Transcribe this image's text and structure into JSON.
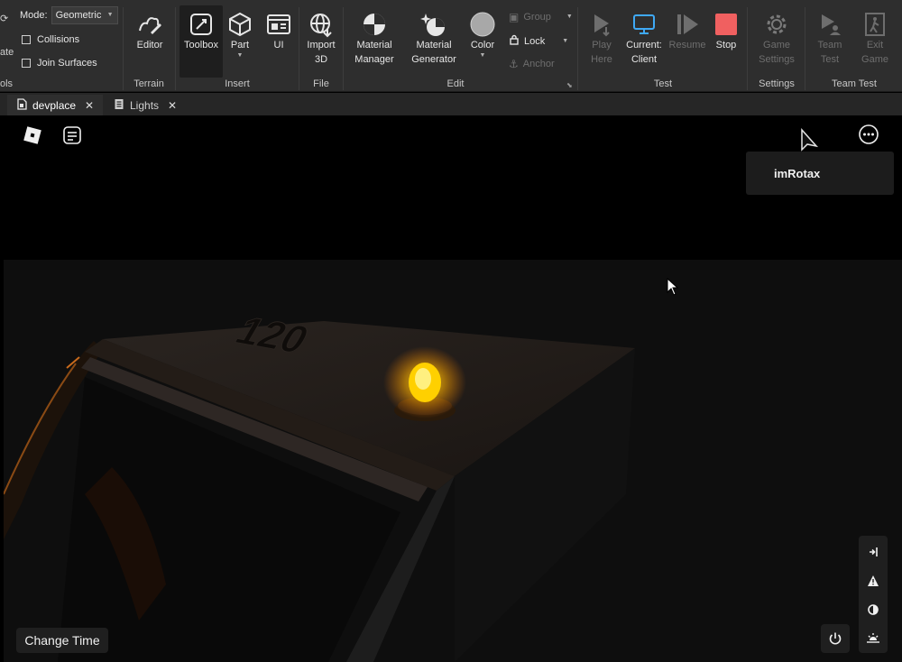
{
  "ribbon": {
    "mode_label": "Mode:",
    "mode_value": "Geometric",
    "collisions_label": "Collisions",
    "join_surfaces_label": "Join Surfaces",
    "cut_left_top": "ate",
    "cut_left_bottom": "ols",
    "editor_label": "Editor",
    "terrain_section": "Terrain",
    "toolbox_label": "Toolbox",
    "part_label": "Part",
    "ui_label": "UI",
    "insert_section": "Insert",
    "import_label": "Import",
    "import_label2": "3D",
    "file_section": "File",
    "material_manager_1": "Material",
    "material_manager_2": "Manager",
    "material_generator_1": "Material",
    "material_generator_2": "Generator",
    "color_label": "Color",
    "group_label": "Group",
    "lock_label": "Lock",
    "anchor_label": "Anchor",
    "edit_section": "Edit",
    "play_here_1": "Play",
    "play_here_2": "Here",
    "current_client_1": "Current:",
    "current_client_2": "Client",
    "resume_label": "Resume",
    "stop_label": "Stop",
    "test_section": "Test",
    "game_settings_1": "Game",
    "game_settings_2": "Settings",
    "settings_section": "Settings",
    "team_test_1": "Team",
    "team_test_2": "Test",
    "exit_game_1": "Exit",
    "exit_game_2": "Game",
    "team_test_section": "Team Test"
  },
  "tabs": [
    {
      "label": "devplace",
      "active": true
    },
    {
      "label": "Lights",
      "active": false
    }
  ],
  "viewport": {
    "player_name": "imRotax",
    "change_time_label": "Change Time",
    "plate_text": "120"
  },
  "colors": {
    "accent_blue": "#3fa9f5",
    "stop_red": "#f06060",
    "glow": "#ffb000"
  }
}
